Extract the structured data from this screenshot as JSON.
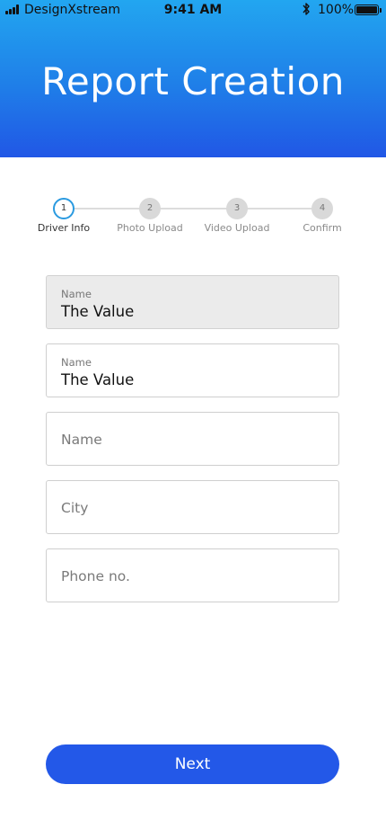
{
  "status_bar": {
    "carrier": "DesignXstream",
    "time": "9:41 AM",
    "battery": "100%"
  },
  "header": {
    "title": "Report Creation"
  },
  "stepper": {
    "steps": [
      {
        "number": "1",
        "label": "Driver Info",
        "active": true
      },
      {
        "number": "2",
        "label": "Photo Upload",
        "active": false
      },
      {
        "number": "3",
        "label": "Video Upload",
        "active": false
      },
      {
        "number": "4",
        "label": "Confirm",
        "active": false
      }
    ]
  },
  "form": {
    "fields": [
      {
        "label": "Name",
        "value": "The Value",
        "state": "disabled"
      },
      {
        "label": "Name",
        "value": "The Value",
        "state": "filled"
      },
      {
        "placeholder": "Name",
        "state": "empty"
      },
      {
        "placeholder": "City",
        "state": "empty"
      },
      {
        "placeholder": "Phone no.",
        "state": "empty"
      }
    ]
  },
  "actions": {
    "next_label": "Next"
  },
  "colors": {
    "header_top": "#22a6f0",
    "header_bottom": "#2157e6",
    "primary_button": "#2358e8",
    "active_step": "#2a9ae0"
  }
}
